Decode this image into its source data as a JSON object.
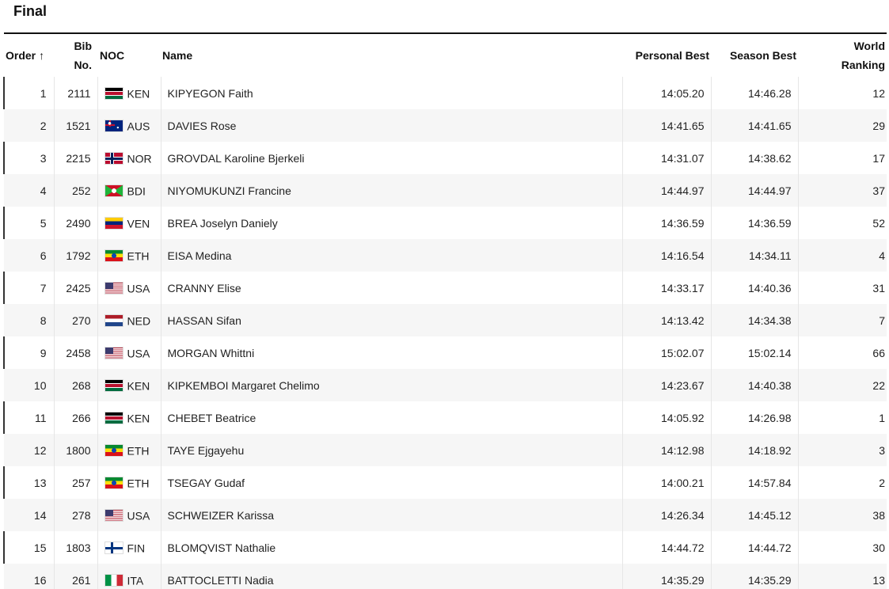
{
  "title": "Final",
  "columns": {
    "order": "Order",
    "sort_icon": "↑",
    "bib_line1": "Bib",
    "bib_line2": "No.",
    "noc": "NOC",
    "name": "Name",
    "personal_best": "Personal Best",
    "season_best": "Season Best",
    "world_ranking_line1": "World",
    "world_ranking_line2": "Ranking"
  },
  "rows": [
    {
      "order": "1",
      "bib": "2111",
      "noc": "KEN",
      "flag": "kenya-flag-icon",
      "name": "KIPYEGON Faith",
      "pb": "14:05.20",
      "sb": "14:46.28",
      "rank": "12"
    },
    {
      "order": "2",
      "bib": "1521",
      "noc": "AUS",
      "flag": "australia-flag-icon",
      "name": "DAVIES Rose",
      "pb": "14:41.65",
      "sb": "14:41.65",
      "rank": "29"
    },
    {
      "order": "3",
      "bib": "2215",
      "noc": "NOR",
      "flag": "norway-flag-icon",
      "name": "GROVDAL Karoline Bjerkeli",
      "pb": "14:31.07",
      "sb": "14:38.62",
      "rank": "17"
    },
    {
      "order": "4",
      "bib": "252",
      "noc": "BDI",
      "flag": "burundi-flag-icon",
      "name": "NIYOMUKUNZI Francine",
      "pb": "14:44.97",
      "sb": "14:44.97",
      "rank": "37"
    },
    {
      "order": "5",
      "bib": "2490",
      "noc": "VEN",
      "flag": "venezuela-flag-icon",
      "name": "BREA Joselyn Daniely",
      "pb": "14:36.59",
      "sb": "14:36.59",
      "rank": "52"
    },
    {
      "order": "6",
      "bib": "1792",
      "noc": "ETH",
      "flag": "ethiopia-flag-icon",
      "name": "EISA Medina",
      "pb": "14:16.54",
      "sb": "14:34.11",
      "rank": "4"
    },
    {
      "order": "7",
      "bib": "2425",
      "noc": "USA",
      "flag": "usa-flag-icon",
      "name": "CRANNY Elise",
      "pb": "14:33.17",
      "sb": "14:40.36",
      "rank": "31"
    },
    {
      "order": "8",
      "bib": "270",
      "noc": "NED",
      "flag": "netherlands-flag-icon",
      "name": "HASSAN Sifan",
      "pb": "14:13.42",
      "sb": "14:34.38",
      "rank": "7"
    },
    {
      "order": "9",
      "bib": "2458",
      "noc": "USA",
      "flag": "usa-flag-icon",
      "name": "MORGAN Whittni",
      "pb": "15:02.07",
      "sb": "15:02.14",
      "rank": "66"
    },
    {
      "order": "10",
      "bib": "268",
      "noc": "KEN",
      "flag": "kenya-flag-icon",
      "name": "KIPKEMBOI Margaret Chelimo",
      "pb": "14:23.67",
      "sb": "14:40.38",
      "rank": "22"
    },
    {
      "order": "11",
      "bib": "266",
      "noc": "KEN",
      "flag": "kenya-flag-icon",
      "name": "CHEBET Beatrice",
      "pb": "14:05.92",
      "sb": "14:26.98",
      "rank": "1"
    },
    {
      "order": "12",
      "bib": "1800",
      "noc": "ETH",
      "flag": "ethiopia-flag-icon",
      "name": "TAYE Ejgayehu",
      "pb": "14:12.98",
      "sb": "14:18.92",
      "rank": "3"
    },
    {
      "order": "13",
      "bib": "257",
      "noc": "ETH",
      "flag": "ethiopia-flag-icon",
      "name": "TSEGAY Gudaf",
      "pb": "14:00.21",
      "sb": "14:57.84",
      "rank": "2"
    },
    {
      "order": "14",
      "bib": "278",
      "noc": "USA",
      "flag": "usa-flag-icon",
      "name": "SCHWEIZER Karissa",
      "pb": "14:26.34",
      "sb": "14:45.12",
      "rank": "38"
    },
    {
      "order": "15",
      "bib": "1803",
      "noc": "FIN",
      "flag": "finland-flag-icon",
      "name": "BLOMQVIST Nathalie",
      "pb": "14:44.72",
      "sb": "14:44.72",
      "rank": "30"
    },
    {
      "order": "16",
      "bib": "261",
      "noc": "ITA",
      "flag": "italy-flag-icon",
      "name": "BATTOCLETTI Nadia",
      "pb": "14:35.29",
      "sb": "14:35.29",
      "rank": "13"
    }
  ]
}
